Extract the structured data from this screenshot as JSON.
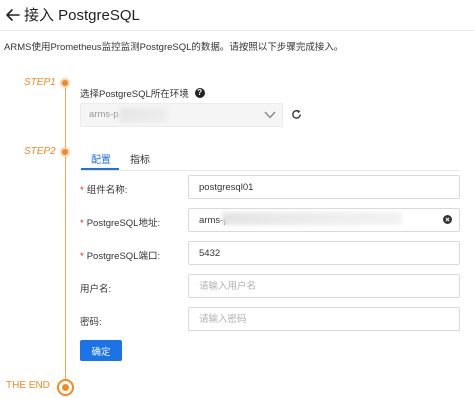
{
  "header": {
    "title": "接入 PostgreSQL"
  },
  "intro": "ARMS使用Prometheus监控监测PostgreSQL的数据。请按照以下步骤完成接入。",
  "steps": {
    "step1": "STEP1",
    "step2": "STEP2",
    "end": "THE END"
  },
  "environment": {
    "label": "选择PostgreSQL所在环境",
    "selected_value": "arms-p"
  },
  "tabs": [
    {
      "label": "配置",
      "active": true
    },
    {
      "label": "指标",
      "active": false
    }
  ],
  "form": {
    "component_name": {
      "required_mark": "*",
      "label": "组件名称:",
      "value": "postgresql01",
      "placeholder": ""
    },
    "address": {
      "required_mark": "*",
      "label": "PostgreSQL地址:",
      "value": "arms-p",
      "placeholder": ""
    },
    "port": {
      "required_mark": "*",
      "label": "PostgreSQL端口:",
      "value": "5432",
      "placeholder": ""
    },
    "username": {
      "label": "用户名:",
      "value": "",
      "placeholder": "请输入用户名"
    },
    "password": {
      "label": "密码:",
      "value": "",
      "placeholder": "请输入密码"
    }
  },
  "confirm_button": "确定",
  "colors": {
    "accent": "#1a73e8",
    "step": "#f08a24",
    "required": "#e02020"
  },
  "icons": {
    "back": "back-arrow-icon",
    "help": "help-icon",
    "chevron": "chevron-down-icon",
    "refresh": "refresh-icon",
    "clear": "clear-icon"
  }
}
